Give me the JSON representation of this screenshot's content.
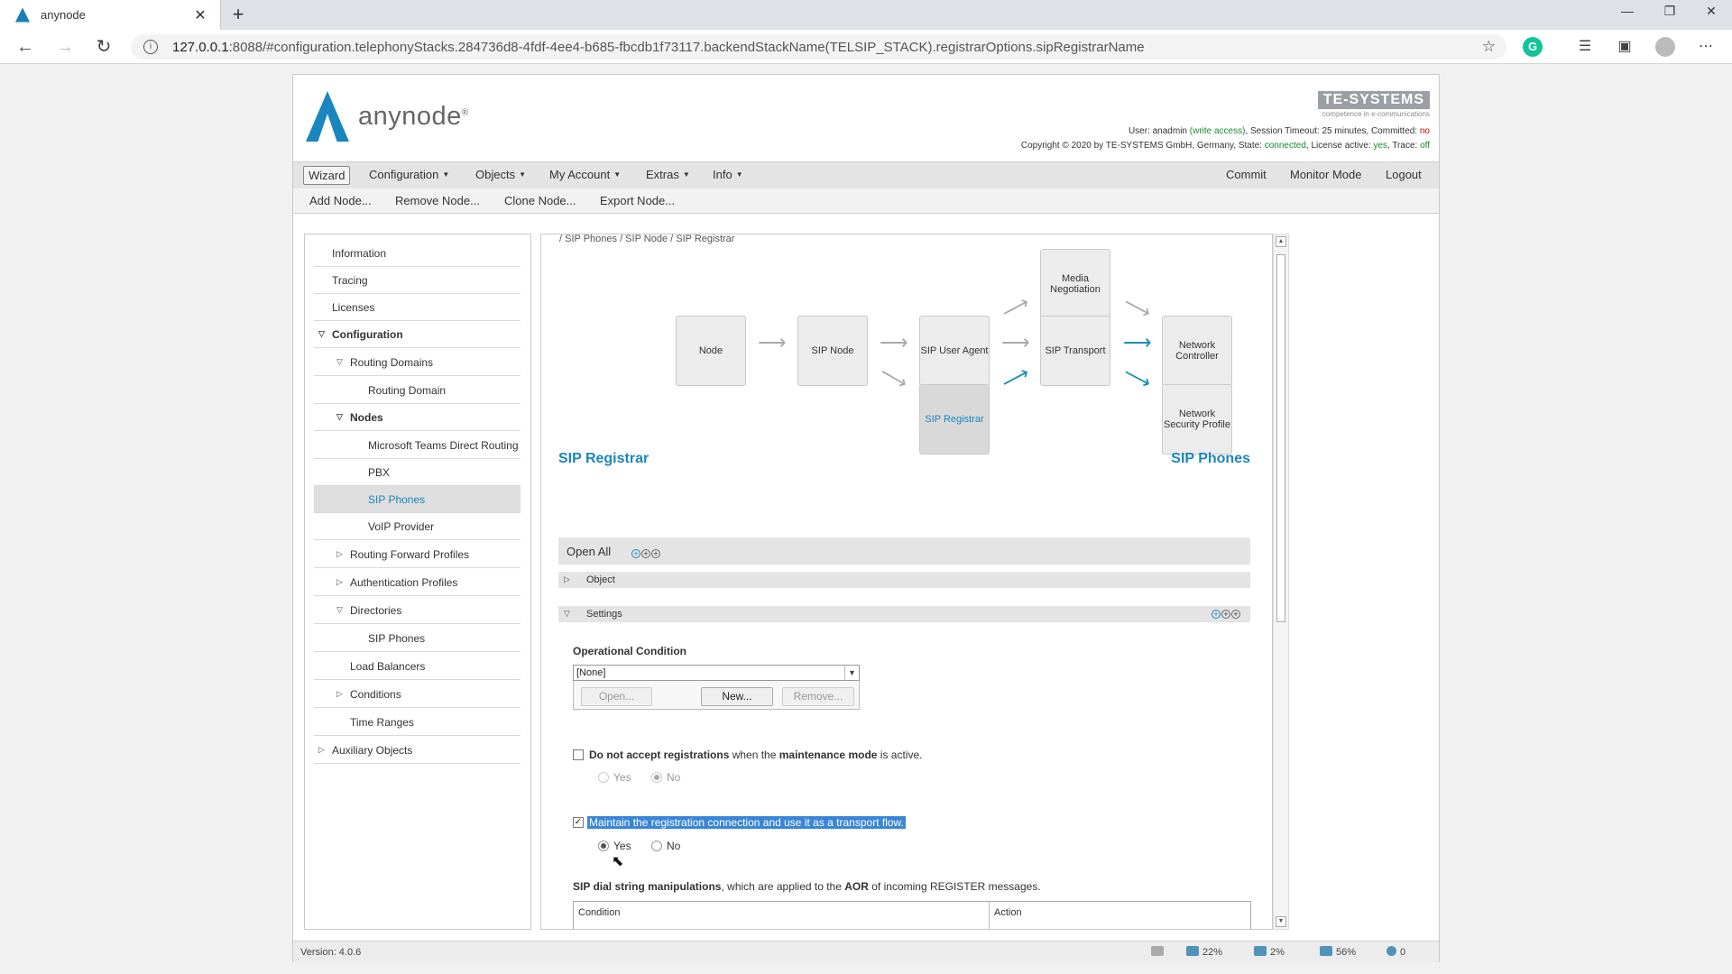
{
  "browser": {
    "tab_title": "anynode",
    "tab_close": "✕",
    "new_tab": "+",
    "url_host": "127.0.0.1",
    "url_rest": ":8088/#configuration.telephonyStacks.284736d8-4fdf-4ee4-b685-fbcdb1f73117.backendStackName(TELSIP_STACK).registrarOptions.sipRegistrarName",
    "win_min": "—",
    "win_max": "❐",
    "win_close": "✕"
  },
  "header": {
    "logo_text": "anynode",
    "logo_reg": "®",
    "brand": "TE-SYSTEMS",
    "brand_tag": "competence in e-communications",
    "status_user_label": "User: ",
    "status_user": "anadmin",
    "status_access": "(write access)",
    "status_session": ", Session Timeout: 25 minutes, Committed: ",
    "status_committed": "no",
    "copyright": "Copyright © 2020 by TE-SYSTEMS GmbH, Germany, State: ",
    "state": "connected",
    "license_label": ", License active: ",
    "license": "yes",
    "trace_label": ", Trace: ",
    "trace": "off"
  },
  "menu": {
    "wizard": "Wizard",
    "configuration": "Configuration",
    "objects": "Objects",
    "my_account": "My Account",
    "extras": "Extras",
    "info": "Info",
    "commit": "Commit",
    "monitor_mode": "Monitor Mode",
    "logout": "Logout"
  },
  "toolbar": {
    "add_node": "Add Node...",
    "remove_node": "Remove Node...",
    "clone_node": "Clone Node...",
    "export_node": "Export Node..."
  },
  "nav": {
    "information": "Information",
    "tracing": "Tracing",
    "licenses": "Licenses",
    "configuration": "Configuration",
    "routing_domains": "Routing Domains",
    "routing_domain": "Routing Domain",
    "nodes": "Nodes",
    "ms_teams": "Microsoft Teams Direct Routing",
    "pbx": "PBX",
    "sip_phones": "SIP Phones",
    "voip_provider": "VoIP Provider",
    "routing_forward_profiles": "Routing Forward Profiles",
    "authentication_profiles": "Authentication Profiles",
    "directories": "Directories",
    "dir_sip_phones": "SIP Phones",
    "load_balancers": "Load Balancers",
    "conditions": "Conditions",
    "time_ranges": "Time Ranges",
    "auxiliary_objects": "Auxiliary Objects"
  },
  "main": {
    "breadcrumb": "/ SIP Phones / SIP Node / SIP Registrar",
    "diagram": {
      "node": "Node",
      "sip_node": "SIP Node",
      "sip_user_agent": "SIP User Agent",
      "media_negotiation": "Media Negotiation",
      "sip_transport": "SIP Transport",
      "network_controller": "Network Controller",
      "sip_registrar": "SIP Registrar",
      "network_security_profile": "Network Security Profile"
    },
    "title": "SIP Registrar",
    "title_right": "SIP Phones",
    "open_all": "Open All",
    "section_object": "Object",
    "section_settings": "Settings",
    "operational_condition_label": "Operational Condition",
    "operational_condition_value": "[None]",
    "btn_open": "Open...",
    "btn_new": "New...",
    "btn_remove": "Remove...",
    "maint_pre": "Do not accept registrations ",
    "maint_when": "when",
    "maint_mid": " the ",
    "maint_mode": "maintenance mode",
    "maint_post": " is active.",
    "yes": "Yes",
    "no": "No",
    "maintain_text": "Maintain the registration connection and use it as a transport flow.",
    "dial_bold": "SIP dial string manipulations",
    "dial_mid": ", which are applied to the ",
    "dial_aor": "AOR",
    "dial_post": " of incoming REGISTER messages.",
    "col_condition": "Condition",
    "col_action": "Action"
  },
  "footer": {
    "version": "Version: 4.0.6",
    "cpu": "22%",
    "mem": "2%",
    "disk": "56%",
    "count": "0"
  }
}
